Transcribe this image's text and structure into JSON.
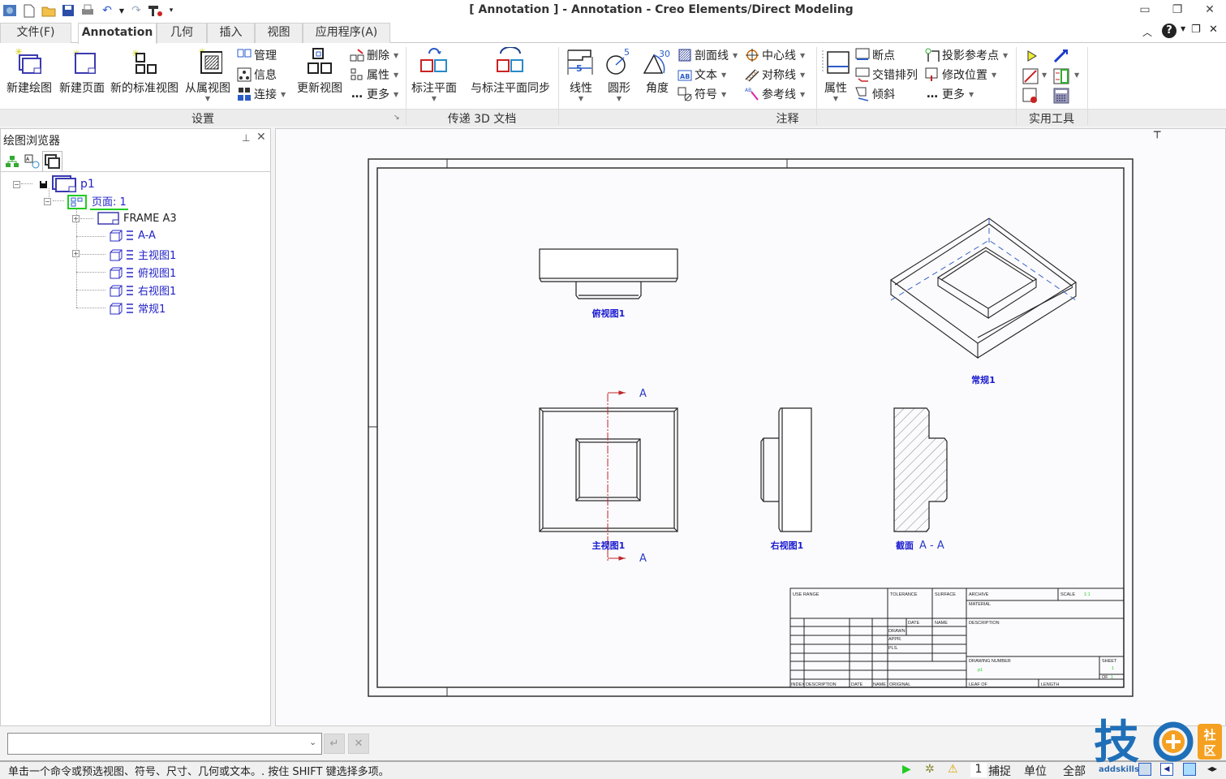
{
  "window": {
    "title": "[ Annotation ] - Annotation - Creo Elements/Direct Modeling",
    "controls": {
      "minimize": "minimize-icon",
      "restore": "restore-icon",
      "close": "close-icon"
    }
  },
  "quick_access": [
    "app-icon",
    "new-icon",
    "open-icon",
    "save-icon",
    "print-icon",
    "undo-icon",
    "redo-icon",
    "tools-icon",
    "customize-icon"
  ],
  "tabs": [
    {
      "label": "文件(F)",
      "active": false
    },
    {
      "label": "Annotation",
      "active": true
    },
    {
      "label": "几何",
      "active": false
    },
    {
      "label": "插入",
      "active": false
    },
    {
      "label": "视图",
      "active": false
    },
    {
      "label": "应用程序(A)",
      "active": false
    }
  ],
  "ribbon": {
    "groups": {
      "setup": "设置",
      "transfer3d": "传递 3D 文档",
      "annotation": "注释",
      "utilities": "实用工具"
    },
    "setup": {
      "new_drawing": "新建绘图",
      "new_page": "新建页面",
      "new_std_view": "新的标准视图",
      "dependent_view": "从属视图",
      "manage": "管理",
      "info": "信息",
      "connect": "连接",
      "update_view": "更新视图",
      "delete": "删除",
      "properties": "属性",
      "more": "更多"
    },
    "transfer3d": {
      "annotation_plane": "标注平面",
      "sync_plane": "与标注平面同步"
    },
    "annotation": {
      "linear": "线性",
      "circular": "圆形",
      "angle": "角度",
      "hatch": "剖面线",
      "text": "文本",
      "symbol": "符号",
      "centerline": "中心线",
      "symmetry": "对称线",
      "reference_line": "参考线",
      "properties": "属性",
      "break": "断点",
      "stagger": "交错排列",
      "oblique": "倾斜",
      "projection_ref": "投影参考点",
      "modify_position": "修改位置",
      "more": "更多",
      "linear_value": "5",
      "circular_value": "5",
      "angle_value": "30"
    }
  },
  "browser": {
    "title": "绘图浏览器",
    "tree": [
      {
        "label": "p1",
        "level": 0,
        "toggle": "-"
      },
      {
        "label": "页面: 1",
        "level": 1,
        "toggle": "-"
      },
      {
        "label": "FRAME A3",
        "level": 2,
        "toggle": "+"
      },
      {
        "label": "A-A",
        "level": 2,
        "toggle": ""
      },
      {
        "label": "主视图1",
        "level": 2,
        "toggle": "+"
      },
      {
        "label": "俯视图1",
        "level": 2,
        "toggle": ""
      },
      {
        "label": "右视图1",
        "level": 2,
        "toggle": ""
      },
      {
        "label": "常规1",
        "level": 2,
        "toggle": ""
      }
    ]
  },
  "drawing": {
    "views": {
      "top_view": "俯视图1",
      "iso_view": "常规1",
      "front_view": "主视图1",
      "right_view": "右视图1",
      "section_prefix": "截面",
      "section_name": "A - A",
      "section_marker": "A"
    },
    "title_block": {
      "use_range": "USE RANGE",
      "tolerance": "TOLERANCE",
      "surface": "SURFACE",
      "archive": "ARCHIVE",
      "scale": "SCALE",
      "scale_value": "1:1",
      "material": "MATERIAL",
      "date": "DATE",
      "name": "NAME",
      "description": "DESCRIPTION",
      "drawn": "DRAWN",
      "appr": "APPR.",
      "pls": "PLS.",
      "drawing_number": "DRAWING NUMBER",
      "drawing_number_value": "p1",
      "sheet": "SHEET",
      "sheet_value": "1",
      "of": "OF",
      "of_value": "1",
      "index": "INDEX",
      "index_desc": "DESCRIPTION",
      "index_date": "DATE",
      "index_name": "NAME",
      "original": "ORIGINAL",
      "leaf_of": "LEAF OF",
      "length": "LENGTH"
    },
    "colors": {
      "label": "#1a1ad0",
      "section_line": "#c0262a",
      "hidden": "#3a64c8",
      "value": "#22cc22"
    }
  },
  "command": {
    "input_value": "",
    "ok_icon": "enter-icon",
    "cancel_icon": "cancel-icon"
  },
  "status": {
    "message": "单击一个命令或预选视图、符号、尺寸、几何或文本。. 按住 SHIFT 键选择多项。",
    "count": "1",
    "snap": "捕捉",
    "units": "单位",
    "all": "全部",
    "watermark_text": "addskills",
    "watermark_logo": "技",
    "watermark_badge": "社区"
  }
}
